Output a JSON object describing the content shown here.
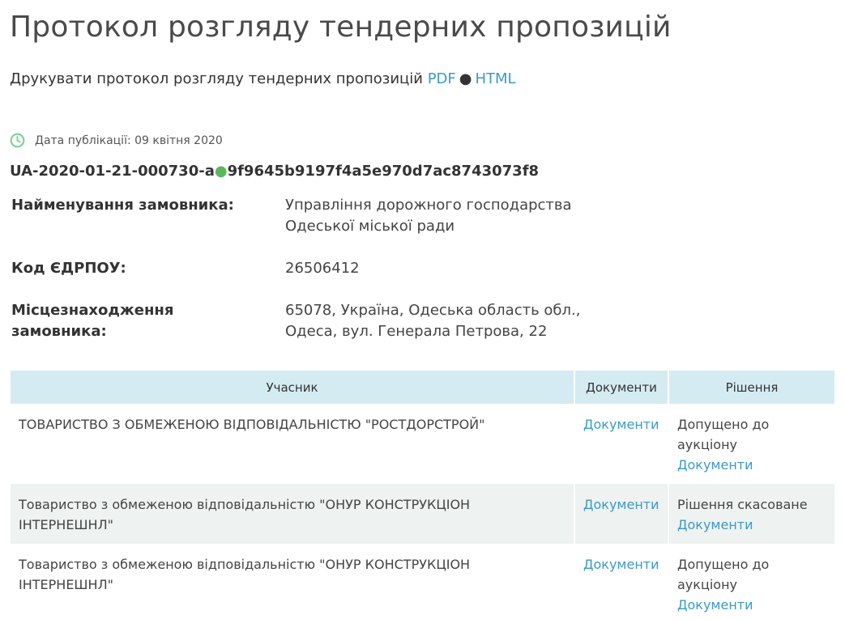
{
  "page": {
    "title": "Протокол розгляду тендерних пропозицій"
  },
  "print": {
    "label": "Друкувати протокол розгляду тендерних пропозицій",
    "pdf": "PDF",
    "separator": "●",
    "html": "HTML"
  },
  "publication": {
    "icon": "clock-icon",
    "text": "Дата публікації: 09 квітня 2020"
  },
  "tender": {
    "id_prefix": "UA-2020-01-21-000730-a",
    "separator": "●",
    "id_suffix": "9f9645b9197f4a5e970d7ac8743073f8"
  },
  "customer": {
    "name_label": "Найменування замовника:",
    "name_value": "Управління дорожного господарства Одеської міської ради",
    "code_label": "Код ЄДРПОУ:",
    "code_value": "26506412",
    "location_label": "Місцезнаходження замовника:",
    "location_value": "65078, Україна, Одеська область обл., Одеса, вул. Генерала Петрова, 22"
  },
  "table": {
    "headers": [
      "Учасник",
      "Документи",
      "Рішення"
    ],
    "rows": [
      {
        "participant": "ТОВАРИСТВО З ОБМЕЖЕНОЮ ВІДПОВІДАЛЬНІСТЮ \"РОСТДОРСТРОЙ\"",
        "documents": "Документи",
        "decision": "Допущено до аукціону",
        "decision_documents": "Документи"
      },
      {
        "participant": "Товариство з обмеженою відповідальністю \"ОНУР КОНСТРУКЦІОН ІНТЕРНЕШНЛ\"",
        "documents": "Документи",
        "decision": "Рішення скасоване",
        "decision_documents": "Документи"
      },
      {
        "participant": "Товариство з обмеженою відповідальністю \"ОНУР КОНСТРУКЦІОН ІНТЕРНЕШНЛ\"",
        "documents": "Документи",
        "decision": "Допущено до аукціону",
        "decision_documents": "Документи"
      }
    ]
  },
  "colors": {
    "link": "#3c9ac4",
    "header_bg": "#d4ebf2",
    "alt_row_bg": "#eef2f1",
    "accent_green": "#5cb85c"
  }
}
